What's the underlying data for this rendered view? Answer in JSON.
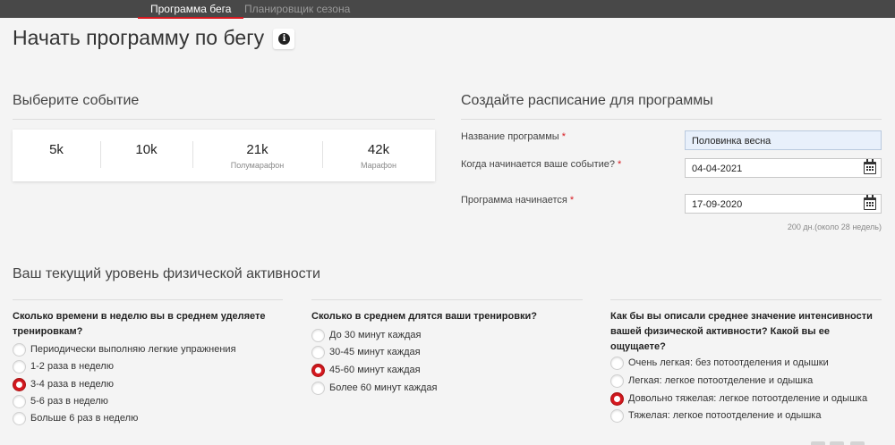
{
  "tabs": [
    {
      "label": "Программа бега",
      "active": true
    },
    {
      "label": "Планировщик сезона",
      "active": false
    }
  ],
  "page": {
    "title": "Начать программу по бегу",
    "info_icon": "info-icon"
  },
  "events": {
    "title": "Выберите событие",
    "items": [
      {
        "value": "5k",
        "sub": ""
      },
      {
        "value": "10k",
        "sub": ""
      },
      {
        "value": "21k",
        "sub": "Полумарафон"
      },
      {
        "value": "42k",
        "sub": "Марафон"
      }
    ]
  },
  "schedule": {
    "title": "Создайте расписание для программы",
    "program_name": {
      "label": "Название программы",
      "value": "Половинка весна"
    },
    "event_date": {
      "label": "Когда начинается ваше событие?",
      "value": "04-04-2021"
    },
    "start_date": {
      "label": "Программа начинается",
      "value": "17-09-2020"
    },
    "required_mark": "*",
    "duration_note": "200 дн.(около 28 недель)"
  },
  "activity": {
    "title": "Ваш текущий уровень физической активности",
    "questions": [
      {
        "text_lines": [
          "Сколько времени в неделю вы в среднем уделяете",
          "тренировкам?"
        ],
        "options": [
          "Периодически выполняю легкие упражнения",
          "1-2 раза в неделю",
          "3-4 раза в неделю",
          "5-6 раз в неделю",
          "Больше 6 раз в неделю"
        ],
        "selected": 2
      },
      {
        "text_lines": [
          "Сколько в среднем длятся ваши тренировки?"
        ],
        "options": [
          "До 30 минут каждая",
          "30-45 минут каждая",
          "45-60 минут каждая",
          "Более 60 минут каждая"
        ],
        "selected": 2
      },
      {
        "text_lines": [
          "Как бы вы описали среднее значение интенсивности",
          "вашей физической активности? Какой вы ее",
          "ощущаете?"
        ],
        "options": [
          "Очень легкая: без потоотделения и одышки",
          "Легкая: легкое потоотделение и одышка",
          "Довольно тяжелая: легкое потоотделение и одышка",
          "Тяжелая: легкое потоотделение и одышка"
        ],
        "selected": 2
      }
    ]
  },
  "colors": {
    "accent": "#d71920",
    "topbar": "#484848",
    "background": "#f4f4f4"
  }
}
